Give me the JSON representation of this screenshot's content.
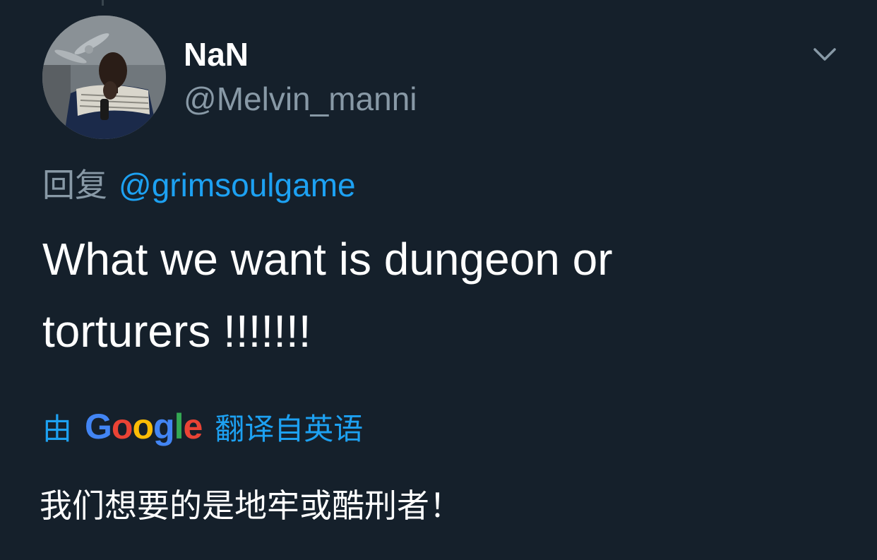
{
  "tweet": {
    "display_name": "NaN",
    "handle": "@Melvin_manni",
    "reply_prefix": "回复",
    "reply_to": "@grimsoulgame",
    "text": "What we want is dungeon or torturers !!!!!!!",
    "translation": {
      "by": "由",
      "provider_letters": [
        "G",
        "o",
        "o",
        "g",
        "l",
        "e"
      ],
      "provider_colors": [
        "#4285f4",
        "#ea4335",
        "#fbbc05",
        "#4285f4",
        "#34a853",
        "#ea4335"
      ],
      "suffix": "翻译自英语",
      "text": "我们想要的是地牢或酷刑者！"
    }
  },
  "colors": {
    "background": "#15202b",
    "primary_text": "#ffffff",
    "secondary_text": "#8899a6",
    "accent": "#1da1f2"
  },
  "icons": {
    "menu": "chevron-down-icon"
  }
}
